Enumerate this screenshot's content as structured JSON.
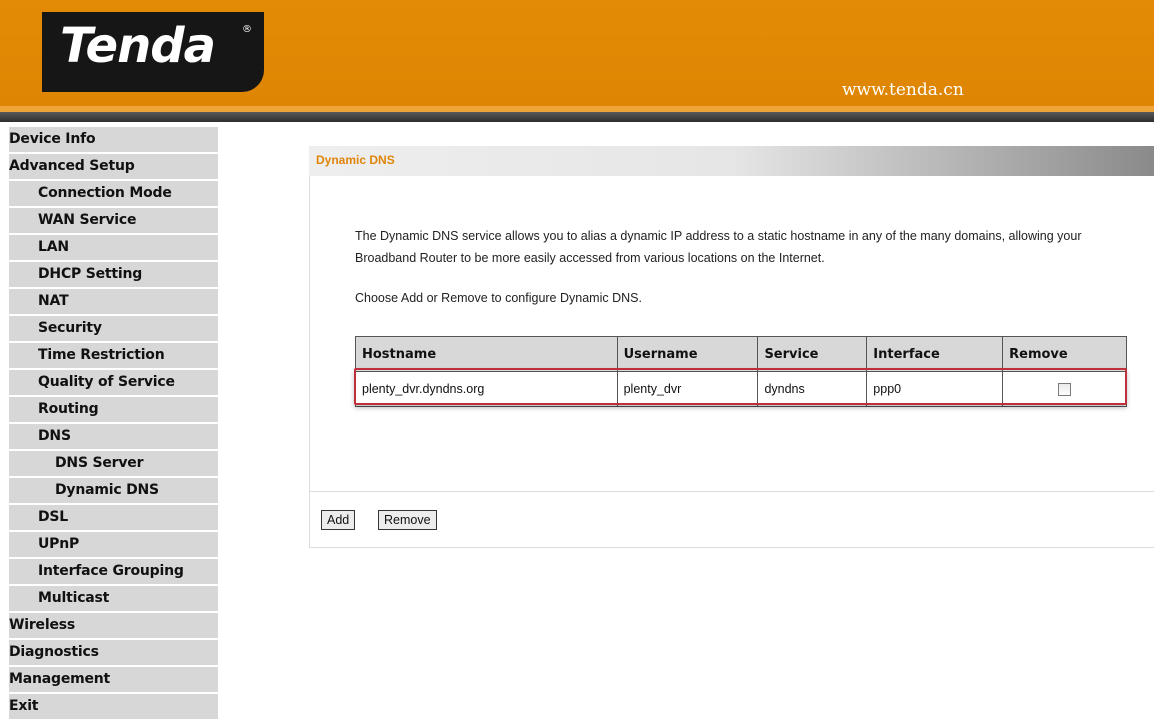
{
  "header": {
    "logo_text": "Tenda",
    "logo_reg": "®",
    "url": "www.tenda.cn"
  },
  "sidebar": {
    "items": [
      {
        "label": "Device Info",
        "level": 0
      },
      {
        "label": "Advanced Setup",
        "level": 0
      },
      {
        "label": "Connection Mode",
        "level": 1
      },
      {
        "label": "WAN Service",
        "level": 1
      },
      {
        "label": "LAN",
        "level": 1
      },
      {
        "label": "DHCP Setting",
        "level": 1
      },
      {
        "label": "NAT",
        "level": 1
      },
      {
        "label": "Security",
        "level": 1
      },
      {
        "label": "Time Restriction",
        "level": 1
      },
      {
        "label": "Quality of Service",
        "level": 1
      },
      {
        "label": "Routing",
        "level": 1
      },
      {
        "label": "DNS",
        "level": 1
      },
      {
        "label": "DNS Server",
        "level": 2
      },
      {
        "label": "Dynamic DNS",
        "level": 2
      },
      {
        "label": "DSL",
        "level": 1
      },
      {
        "label": "UPnP",
        "level": 1
      },
      {
        "label": "Interface Grouping",
        "level": 1
      },
      {
        "label": "Multicast",
        "level": 1
      },
      {
        "label": "Wireless",
        "level": 0
      },
      {
        "label": "Diagnostics",
        "level": 0
      },
      {
        "label": "Management",
        "level": 0
      },
      {
        "label": "Exit",
        "level": 0
      }
    ]
  },
  "main": {
    "section_title": "Dynamic DNS",
    "description": "The Dynamic DNS service allows you to alias a dynamic IP address to a static hostname in any of the many domains, allowing your Broadband Router to be more easily accessed from various locations on the Internet.",
    "instruction": "Choose Add or Remove to configure Dynamic DNS.",
    "table": {
      "headers": [
        "Hostname",
        "Username",
        "Service",
        "Interface",
        "Remove"
      ],
      "rows": [
        {
          "hostname": "plenty_dvr.dyndns.org",
          "username": "plenty_dvr",
          "service": "dyndns",
          "interface": "ppp0",
          "remove_checked": false
        }
      ]
    },
    "buttons": {
      "add": "Add",
      "remove": "Remove"
    }
  },
  "colors": {
    "header_orange": "#e38b06",
    "section_title": "#e0850a",
    "highlight_red": "#c0303a",
    "nav_bg": "#d7d7d7"
  }
}
